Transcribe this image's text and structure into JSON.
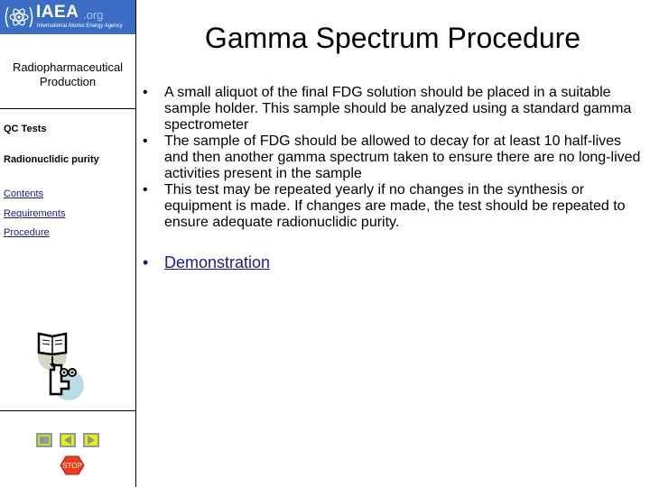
{
  "logo": {
    "name": "IAEA",
    "suffix": ".org",
    "agency": "International Atomic Energy Agency",
    "color": "#3c6dc5"
  },
  "sidebar": {
    "title_line1": "Radiopharmaceutical",
    "title_line2": "Production",
    "section": "QC Tests",
    "subsection": "Radionuclidic purity",
    "links": [
      "Contents",
      "Requirements",
      "Procedure"
    ],
    "link_color": "#1a1a8c",
    "nav_buttons": [
      "home-button",
      "previous-button",
      "next-button"
    ],
    "stop_label": "STOP"
  },
  "main": {
    "title": "Gamma Spectrum Procedure",
    "bullets": [
      "A small aliquot of the final FDG solution should be placed in a suitable sample holder.  This sample should be analyzed using a standard gamma spectrometer",
      "The sample of FDG should be allowed to decay for at least 10 half-lives and then another gamma spectrum taken to ensure there are no long-lived activities present in the sample",
      "This test may be repeated yearly if no changes in the synthesis or equipment is made.  If changes are made, the test should be repeated to ensure adequate radionuclidic purity."
    ],
    "bullet_char": "•",
    "demo_link": "Demonstration"
  }
}
